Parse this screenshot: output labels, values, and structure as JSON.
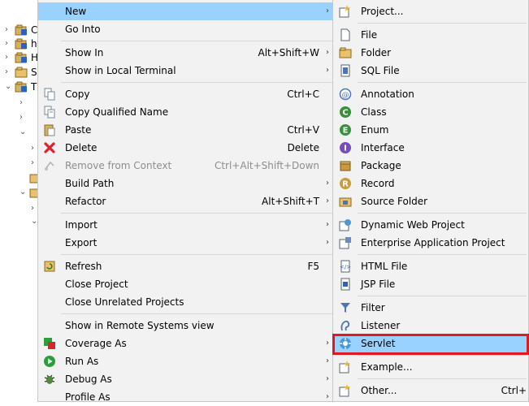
{
  "tree": {
    "rows": [
      {
        "label": "C",
        "chevron": "›"
      },
      {
        "label": "h",
        "chevron": "›"
      },
      {
        "label": "H",
        "chevron": "›"
      },
      {
        "label": "S",
        "chevron": "›"
      },
      {
        "label": "T",
        "chevron": "⌄"
      }
    ]
  },
  "context_menu": {
    "items": {
      "new": {
        "label": "New"
      },
      "go_into": {
        "label": "Go Into"
      },
      "show_in": {
        "label": "Show In",
        "accel": "Alt+Shift+W"
      },
      "show_local_terminal": {
        "label": "Show in Local Terminal"
      },
      "copy": {
        "label": "Copy",
        "accel": "Ctrl+C"
      },
      "copy_qualified": {
        "label": "Copy Qualified Name"
      },
      "paste": {
        "label": "Paste",
        "accel": "Ctrl+V"
      },
      "delete": {
        "label": "Delete",
        "accel": "Delete"
      },
      "remove_context": {
        "label": "Remove from Context",
        "accel": "Ctrl+Alt+Shift+Down"
      },
      "build_path": {
        "label": "Build Path"
      },
      "refactor": {
        "label": "Refactor",
        "accel": "Alt+Shift+T"
      },
      "import": {
        "label": "Import"
      },
      "export": {
        "label": "Export"
      },
      "refresh": {
        "label": "Refresh",
        "accel": "F5"
      },
      "close_project": {
        "label": "Close Project"
      },
      "close_unrelated": {
        "label": "Close Unrelated Projects"
      },
      "show_remote": {
        "label": "Show in Remote Systems view"
      },
      "coverage_as": {
        "label": "Coverage As"
      },
      "run_as": {
        "label": "Run As"
      },
      "debug_as": {
        "label": "Debug As"
      },
      "profile_as": {
        "label": "Profile As"
      }
    }
  },
  "submenu_new": {
    "items": {
      "project": {
        "label": "Project..."
      },
      "file": {
        "label": "File"
      },
      "folder": {
        "label": "Folder"
      },
      "sql_file": {
        "label": "SQL File"
      },
      "annotation": {
        "label": "Annotation"
      },
      "class": {
        "label": "Class"
      },
      "enum": {
        "label": "Enum"
      },
      "interface": {
        "label": "Interface"
      },
      "package": {
        "label": "Package"
      },
      "record": {
        "label": "Record"
      },
      "source_folder": {
        "label": "Source Folder"
      },
      "dynamic_web": {
        "label": "Dynamic Web Project"
      },
      "enterprise_app": {
        "label": "Enterprise Application Project"
      },
      "html_file": {
        "label": "HTML File"
      },
      "jsp_file": {
        "label": "JSP File"
      },
      "filter": {
        "label": "Filter"
      },
      "listener": {
        "label": "Listener"
      },
      "servlet": {
        "label": "Servlet"
      },
      "example": {
        "label": "Example..."
      },
      "other": {
        "label": "Other...",
        "accel": "Ctrl+"
      }
    }
  },
  "colors": {
    "hover": "#99d1ff",
    "highlight_box": "#e2171f",
    "menu_bg": "#f2f2f2"
  }
}
